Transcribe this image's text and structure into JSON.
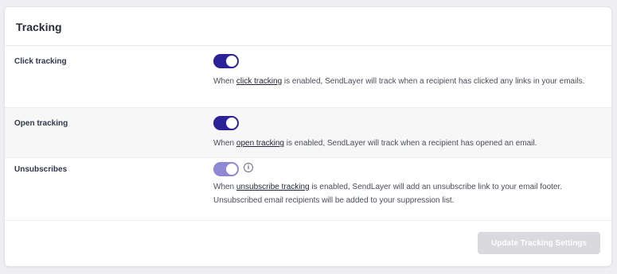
{
  "card": {
    "title": "Tracking"
  },
  "rows": [
    {
      "label": "Click tracking",
      "toggle_on": true,
      "desc_prefix": "When ",
      "desc_link": "click tracking",
      "desc_suffix": " is enabled, SendLayer will track when a recipient has clicked any links in your emails."
    },
    {
      "label": "Open tracking",
      "toggle_on": true,
      "desc_prefix": "When ",
      "desc_link": "open tracking",
      "desc_suffix": " is enabled, SendLayer will track when a recipient has opened an email."
    },
    {
      "label": "Unsubscribes",
      "toggle_on": true,
      "toggle_disabled": true,
      "info_icon": "info-icon",
      "info_glyph": "i",
      "desc_prefix": "When ",
      "desc_link": "unsubscribe tracking",
      "desc_suffix": " is enabled, SendLayer will add an unsubscribe link to your email footer. Unsubscribed email recipients will be added to your suppression list."
    }
  ],
  "footer": {
    "update_label": "Update Tracking Settings",
    "update_disabled": true
  },
  "colors": {
    "toggle_active": "#2b229a",
    "toggle_disabled": "#8f88d3",
    "button_disabled": "#d9d9de"
  }
}
